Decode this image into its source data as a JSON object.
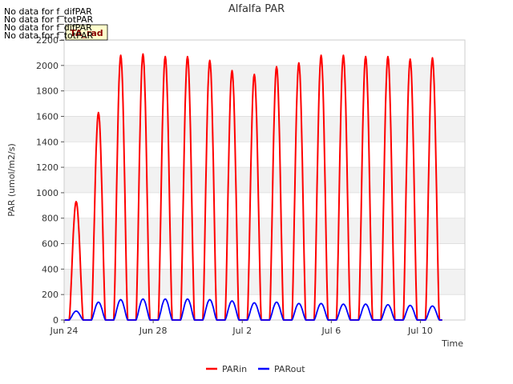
{
  "no_data_messages": [
    "No data for f_difPAR",
    "No data for f_totPAR",
    "No data for f_difPAR",
    "No data for f_totPAR"
  ],
  "badge": {
    "label": "TA_rad",
    "fill": "#ffffcc",
    "text_color": "#8b0000"
  },
  "chart_data": {
    "type": "line",
    "title": "Alfalfa PAR",
    "xlabel": "Time",
    "ylabel": "PAR (umol/m2/s)",
    "xlim": [
      "2024-06-24",
      "2024-07-12"
    ],
    "x_ticks": [
      {
        "date": "2024-06-24",
        "label": "Jun 24"
      },
      {
        "date": "2024-06-28",
        "label": "Jun 28"
      },
      {
        "date": "2024-07-02",
        "label": "Jul 2"
      },
      {
        "date": "2024-07-06",
        "label": "Jul 6"
      },
      {
        "date": "2024-07-10",
        "label": "Jul 10"
      }
    ],
    "ylim": [
      0,
      2200
    ],
    "y_ticks": [
      0,
      200,
      400,
      600,
      800,
      1000,
      1200,
      1400,
      1600,
      1800,
      2000,
      2200
    ],
    "grid": true,
    "legend_position": "bottom-center",
    "series": [
      {
        "name": "PARin",
        "color": "#ff0000",
        "daily_peaks": [
          {
            "date": "2024-06-24",
            "peak": 930
          },
          {
            "date": "2024-06-25",
            "peak": 1630
          },
          {
            "date": "2024-06-26",
            "peak": 2080
          },
          {
            "date": "2024-06-27",
            "peak": 2090
          },
          {
            "date": "2024-06-28",
            "peak": 2070
          },
          {
            "date": "2024-06-29",
            "peak": 2070
          },
          {
            "date": "2024-06-30",
            "peak": 2040
          },
          {
            "date": "2024-07-01",
            "peak": 1960
          },
          {
            "date": "2024-07-02",
            "peak": 1930
          },
          {
            "date": "2024-07-03",
            "peak": 1990
          },
          {
            "date": "2024-07-04",
            "peak": 2020
          },
          {
            "date": "2024-07-05",
            "peak": 2080
          },
          {
            "date": "2024-07-06",
            "peak": 2080
          },
          {
            "date": "2024-07-07",
            "peak": 2070
          },
          {
            "date": "2024-07-08",
            "peak": 2070
          },
          {
            "date": "2024-07-09",
            "peak": 2050
          },
          {
            "date": "2024-07-10",
            "peak": 2060
          }
        ]
      },
      {
        "name": "PARout",
        "color": "#0000ff",
        "daily_peaks": [
          {
            "date": "2024-06-24",
            "peak": 70
          },
          {
            "date": "2024-06-25",
            "peak": 140
          },
          {
            "date": "2024-06-26",
            "peak": 160
          },
          {
            "date": "2024-06-27",
            "peak": 165
          },
          {
            "date": "2024-06-28",
            "peak": 165
          },
          {
            "date": "2024-06-29",
            "peak": 165
          },
          {
            "date": "2024-06-30",
            "peak": 160
          },
          {
            "date": "2024-07-01",
            "peak": 150
          },
          {
            "date": "2024-07-02",
            "peak": 135
          },
          {
            "date": "2024-07-03",
            "peak": 140
          },
          {
            "date": "2024-07-04",
            "peak": 130
          },
          {
            "date": "2024-07-05",
            "peak": 130
          },
          {
            "date": "2024-07-06",
            "peak": 125
          },
          {
            "date": "2024-07-07",
            "peak": 125
          },
          {
            "date": "2024-07-08",
            "peak": 120
          },
          {
            "date": "2024-07-09",
            "peak": 115
          },
          {
            "date": "2024-07-10",
            "peak": 110
          }
        ]
      }
    ]
  }
}
